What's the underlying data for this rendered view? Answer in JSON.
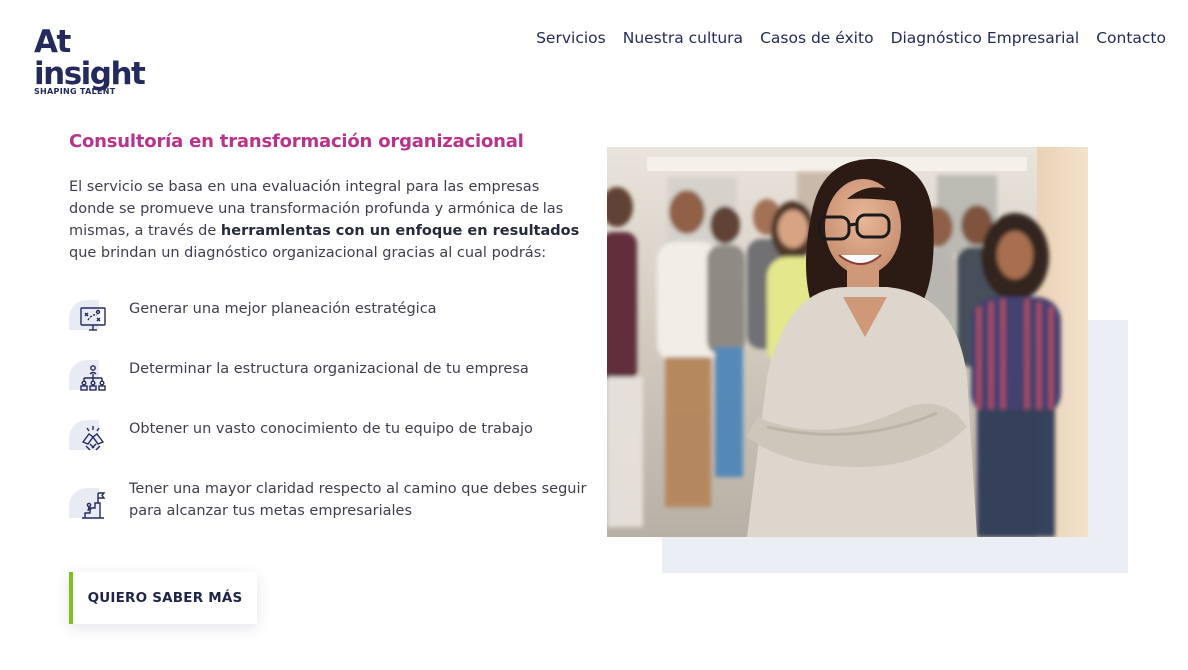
{
  "brand": {
    "name": "At insight",
    "tagline": "SHAPING TALENT",
    "primary_color": "#242a5c",
    "accent_color": "#b8338a",
    "cta_accent_color": "#7fc21f"
  },
  "nav": {
    "items": [
      "Servicios",
      "Nuestra cultura",
      "Casos de éxito",
      "Diagnóstico Empresarial",
      "Contacto"
    ]
  },
  "section": {
    "title": "Consultoría en transformación organizacional",
    "intro_part1": "El servicio se basa en una evaluación integral para las empresas donde se promueve una transformación profunda y armónica de las mismas, a través de ",
    "intro_bold": "herramlentas con un enfoque en resultados",
    "intro_part2": " que brindan un diagnóstico organizacional gracias al cual podrás:",
    "benefits": [
      {
        "icon": "strategy-board-icon",
        "text": "Generar una mejor planeación estratégica"
      },
      {
        "icon": "org-chart-icon",
        "text": "Determinar la estructura organizacional de tu empresa"
      },
      {
        "icon": "team-handshake-icon",
        "text": "Obtener un vasto conocimiento de tu equipo de trabajo"
      },
      {
        "icon": "goal-stairs-icon",
        "text": "Tener una mayor claridad respecto al camino que debes seguir para alcanzar tus metas empresariales"
      }
    ],
    "cta_label": "QUIERO SABER MÁS"
  }
}
